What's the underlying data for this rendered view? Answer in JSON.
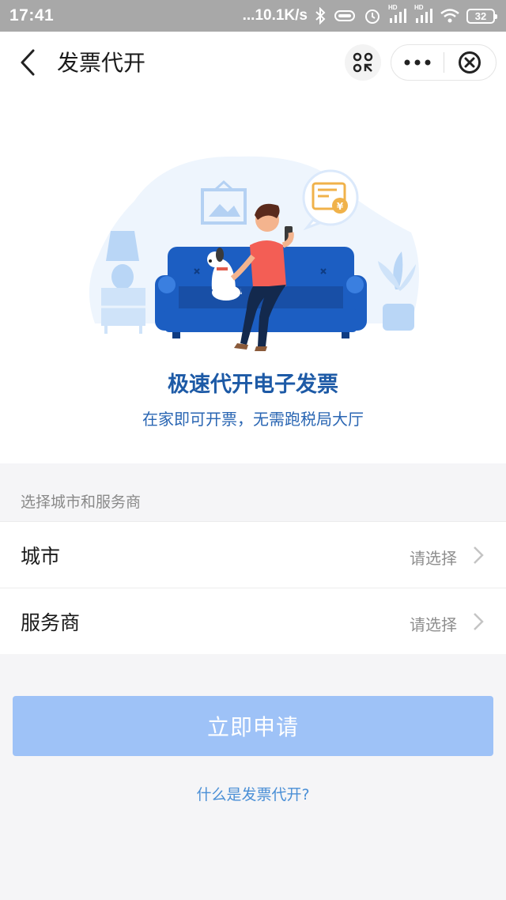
{
  "status_bar": {
    "time": "17:41",
    "network_speed": "...10.1K/s",
    "hd_label_1": "HD",
    "hd_label_2": "HD",
    "battery": "32"
  },
  "nav": {
    "title": "发票代开",
    "icons": [
      "back-icon",
      "scan-icon",
      "more-icon",
      "close-icon"
    ]
  },
  "hero": {
    "title": "极速代开电子发票",
    "subtitle": "在家即可开票，无需跑税局大厅",
    "invoice_symbol": "¥"
  },
  "form": {
    "section_label": "选择城市和服务商",
    "rows": [
      {
        "label": "城市",
        "value": "请选择"
      },
      {
        "label": "服务商",
        "value": "请选择"
      }
    ]
  },
  "actions": {
    "apply_label": "立即申请",
    "help_link": "什么是发票代开?"
  },
  "colors": {
    "accent": "#2a66b3",
    "button_disabled": "#9ec2f7",
    "link": "#4a8fd6",
    "sofa": "#1c5ec2"
  }
}
